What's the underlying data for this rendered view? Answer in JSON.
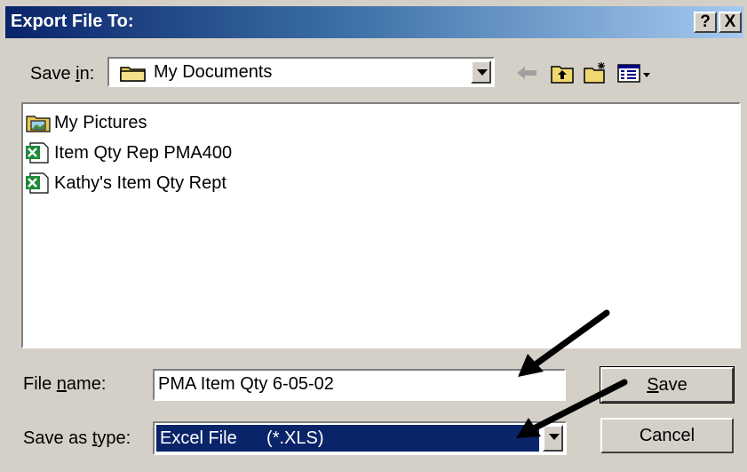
{
  "window": {
    "title": "Export File To:",
    "help_label": "?",
    "close_label": "X"
  },
  "save_in": {
    "label": "Save in:",
    "access_key": "i",
    "value": "My Documents"
  },
  "toolbar": {
    "back_icon": "back-arrow-icon",
    "up_icon": "up-folder-icon",
    "new_folder_icon": "new-folder-icon",
    "views_icon": "views-menu-icon"
  },
  "files": [
    {
      "name": "My Pictures",
      "icon": "folder-pictures-icon"
    },
    {
      "name": "Item Qty Rep PMA400",
      "icon": "excel-file-icon"
    },
    {
      "name": "Kathy's Item Qty Rept",
      "icon": "excel-file-icon"
    }
  ],
  "filename": {
    "label": "File name:",
    "access_key": "n",
    "value": "PMA Item Qty 6-05-02"
  },
  "save_as_type": {
    "label": "Save as type:",
    "access_key": "t",
    "value": "Excel File      (*.XLS)"
  },
  "buttons": {
    "save": "Save",
    "cancel": "Cancel"
  },
  "colors": {
    "title_start": "#0a246a",
    "title_end": "#a6caf0",
    "selection": "#0a246a",
    "face": "#d4d0c8"
  }
}
